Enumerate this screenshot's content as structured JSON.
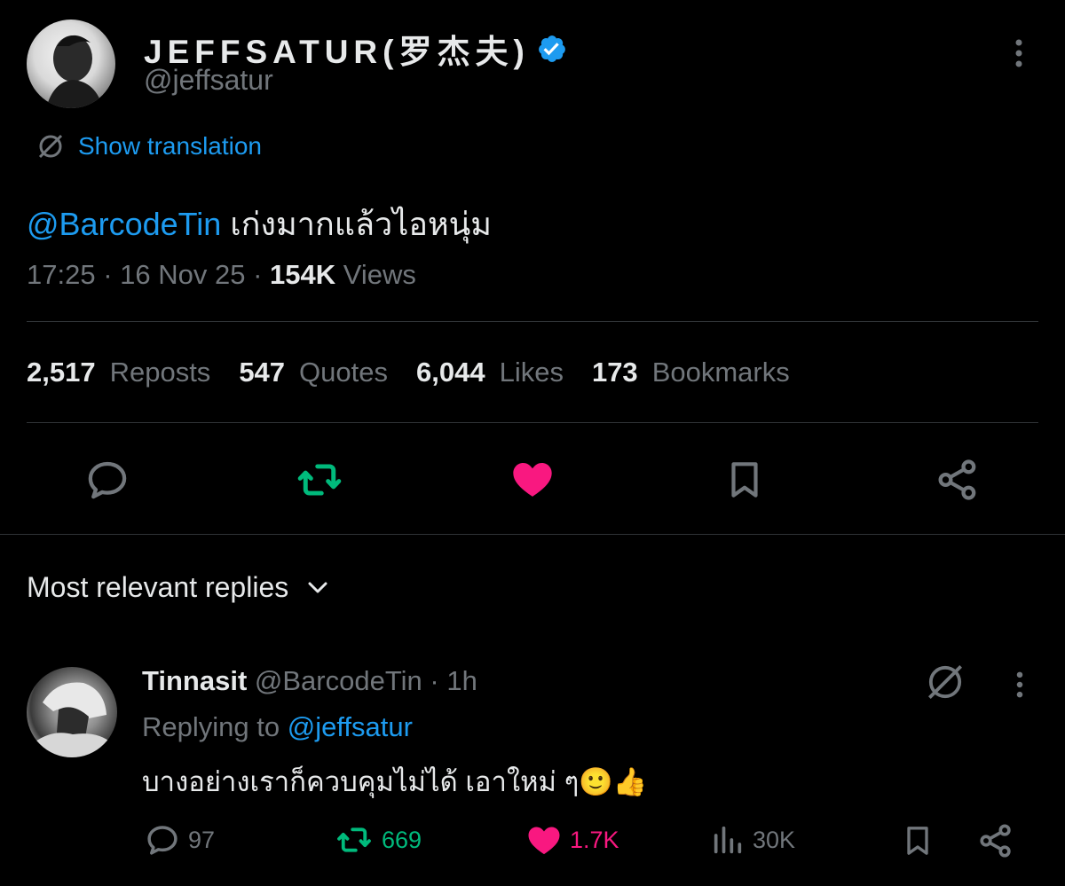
{
  "author": {
    "display_name": "JEFFSATUR(罗杰夫)",
    "handle": "@jeffsatur"
  },
  "translation": {
    "label": "Show translation"
  },
  "tweet": {
    "mention": "@BarcodeTin",
    "text": " เก่งมากแล้วไอหนุ่ม",
    "time": "17:25",
    "date": "16 Nov 25",
    "views_count": "154K",
    "views_label": "Views",
    "separator": " · "
  },
  "stats": {
    "reposts_count": "2,517",
    "reposts_label": "Reposts",
    "quotes_count": "547",
    "quotes_label": "Quotes",
    "likes_count": "6,044",
    "likes_label": "Likes",
    "bookmarks_count": "173",
    "bookmarks_label": "Bookmarks"
  },
  "actions": [
    "reply-icon",
    "repost-icon",
    "like-icon",
    "bookmark-icon",
    "share-icon"
  ],
  "replies_section": {
    "label": "Most relevant replies"
  },
  "reply": {
    "name": "Tinnasit",
    "handle": "@BarcodeTin",
    "time": "1h",
    "separator": " · ",
    "replying_label": "Replying to ",
    "replying_handle": "@jeffsatur",
    "text": "บางอย่างเราก็ควบคุมไม่ได้ เอาใหม่ ๆ🙂👍",
    "replies": "97",
    "reposts": "669",
    "likes": "1.7K",
    "views": "30K"
  },
  "colors": {
    "background": "#000000",
    "text": "#e7e9ea",
    "muted": "#71767b",
    "link": "#1d9bf0",
    "repost_active": "#00ba7c",
    "like_active": "#f91880",
    "divider": "#2f3336"
  }
}
